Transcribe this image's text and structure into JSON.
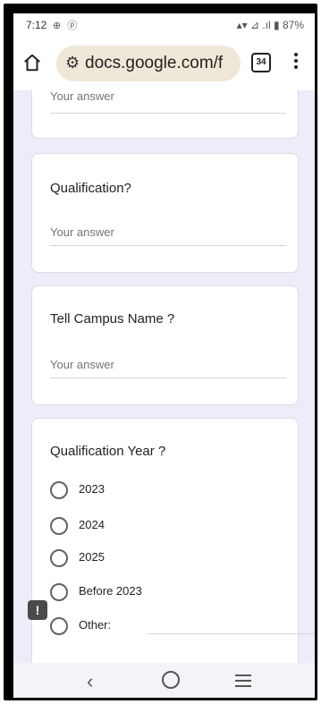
{
  "status_bar": {
    "time": "7:12",
    "icons_left": "⊕ ⓟ",
    "right": "▴▾ ⊿ .ıl ▮ 87%"
  },
  "browser": {
    "url": "docs.google.com/f",
    "tab_count": "34"
  },
  "form": {
    "answer_placeholder": "Your answer",
    "questions": [
      {
        "title": "Qualification?",
        "placeholder": "Your answer"
      },
      {
        "title": "Tell Campus Name ?",
        "placeholder": "Your answer"
      }
    ],
    "radio_question": {
      "title": "Qualification Year ?",
      "options": [
        "2023",
        "2024",
        "2025",
        "Before 2023",
        "Other:"
      ]
    }
  },
  "feedback_label": "!",
  "colors": {
    "background": "#f0ebf8",
    "card": "#ffffff",
    "url_pill": "#efe7d8"
  }
}
